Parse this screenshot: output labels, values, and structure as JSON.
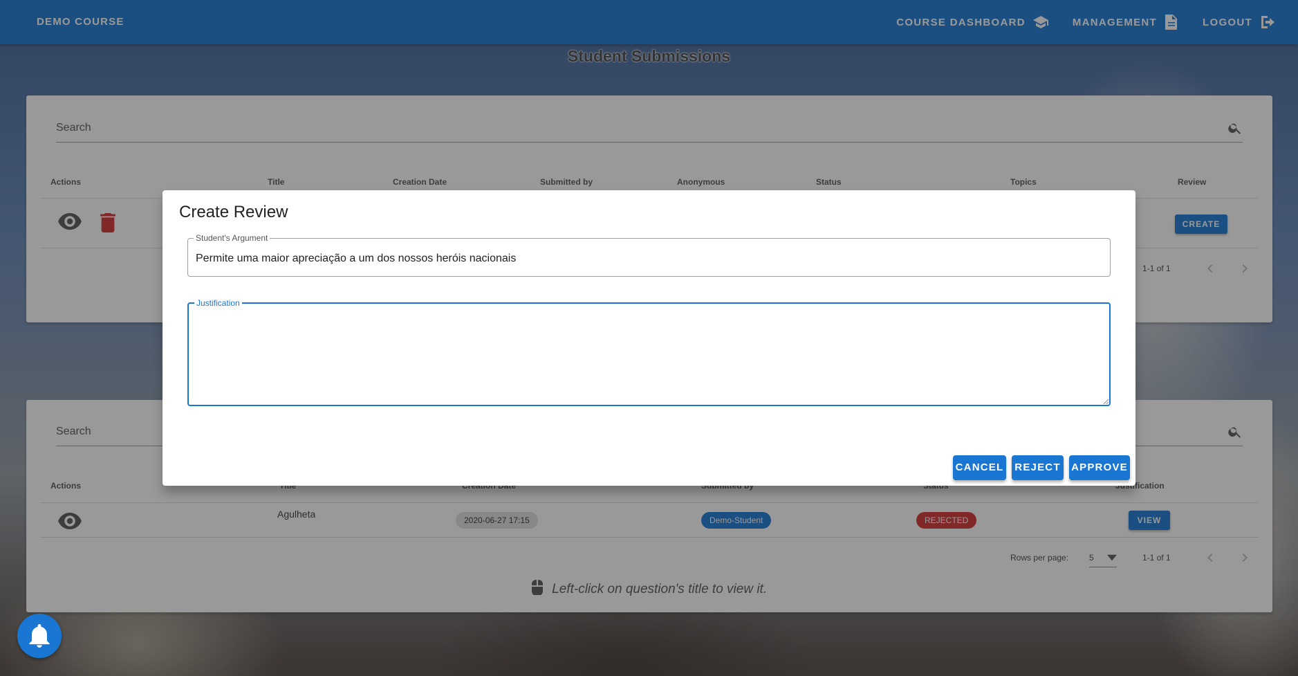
{
  "appbar": {
    "brand": "DEMO COURSE",
    "nav": [
      {
        "label": "COURSE DASHBOARD",
        "icon": "school-icon"
      },
      {
        "label": "MANAGEMENT",
        "icon": "document-icon"
      },
      {
        "label": "LOGOUT",
        "icon": "logout-icon"
      }
    ]
  },
  "page": {
    "title": "Student Submissions"
  },
  "top_table": {
    "search_placeholder": "Search",
    "headers": [
      "Actions",
      "Title",
      "Creation Date",
      "Submitted by",
      "Anonymous",
      "Status",
      "Topics",
      "Review"
    ],
    "row": {
      "review_button": "CREATE"
    },
    "pagination": "1-1 of 1"
  },
  "bottom_table": {
    "search_placeholder": "Search",
    "headers": [
      "Actions",
      "Title",
      "Creation Date",
      "Submitted by",
      "Status",
      "Justification"
    ],
    "row": {
      "title": "Agulheta",
      "creation_date": "2020-06-27 17:15",
      "submitted_by": "Demo-Student",
      "status": "REJECTED",
      "justification_button": "VIEW"
    },
    "rows_per_page_label": "Rows per page:",
    "rows_per_page_value": "5",
    "pagination": "1-1 of 1",
    "hint": "Left-click on question's title to view it."
  },
  "dialog": {
    "title": "Create Review",
    "argument_label": "Student's Argument",
    "argument_value": "Permite uma maior apreciação a um dos nossos heróis nacionais",
    "justification_label": "Justification",
    "justification_value": "",
    "buttons": {
      "cancel": "CANCEL",
      "reject": "REJECT",
      "approve": "APPROVE"
    }
  },
  "colors": {
    "primary": "#1976d2",
    "danger": "#d32f2f",
    "chip_grey": "#e0e0e0"
  }
}
